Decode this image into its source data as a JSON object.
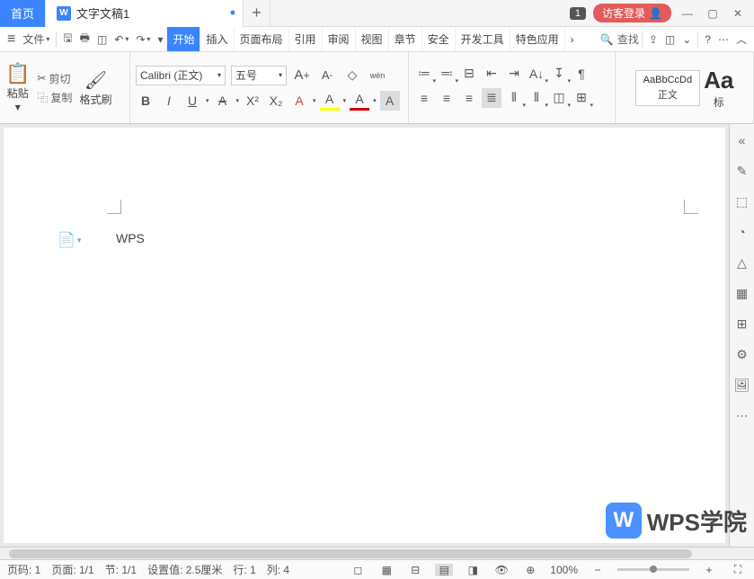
{
  "titlebar": {
    "home_tab": "首页",
    "doc_tab": "文字文稿1",
    "doc_icon_letter": "W",
    "dirty_indicator": "•",
    "add_tab": "+",
    "notif_count": "1",
    "login_label": "访客登录"
  },
  "menubar": {
    "file_label": "文件",
    "tabs": [
      "开始",
      "插入",
      "页面布局",
      "引用",
      "审阅",
      "视图",
      "章节",
      "安全",
      "开发工具",
      "特色应用"
    ],
    "active_index": 0,
    "more_chevron": "›",
    "search_label": "查找"
  },
  "ribbon": {
    "clipboard": {
      "paste": "粘贴",
      "cut": "剪切",
      "copy": "复制",
      "format_painter": "格式刷"
    },
    "font": {
      "name": "Calibri (正文)",
      "size": "五号",
      "grow": "A",
      "shrink": "A",
      "clear": "⌫",
      "phonetic": "wén",
      "bold": "B",
      "italic": "I",
      "underline": "U",
      "strike": "A",
      "super": "X²",
      "sub": "X₂",
      "textfx": "A",
      "highlight": "A",
      "fontcolor": "A",
      "boxA": "A"
    },
    "paragraph": {
      "icons_top": [
        "≔",
        "≕",
        "⊟",
        "☱",
        "⇤",
        "⇥",
        "A↓",
        "↧",
        "¶"
      ],
      "icons_bot": [
        "≡",
        "≡",
        "≡",
        "≣",
        "⫴",
        "⫴",
        "◫",
        "⊡",
        "⊞"
      ]
    },
    "styles": {
      "preview": "AaBbCcDd",
      "name": "正文",
      "big_a": "Aa",
      "label2": "标"
    }
  },
  "document": {
    "content": "WPS",
    "reveal_codes_dropdown": "▾"
  },
  "statusbar": {
    "page_code": "页码: 1",
    "page": "页面: 1/1",
    "section": "节: 1/1",
    "setting": "设置值: 2.5厘米",
    "row": "行: 1",
    "col": "列: 4",
    "zoom": "100%",
    "zoom_in": "+",
    "zoom_out": "−"
  },
  "watermark": {
    "logo": "W",
    "text": "WPS学院"
  }
}
